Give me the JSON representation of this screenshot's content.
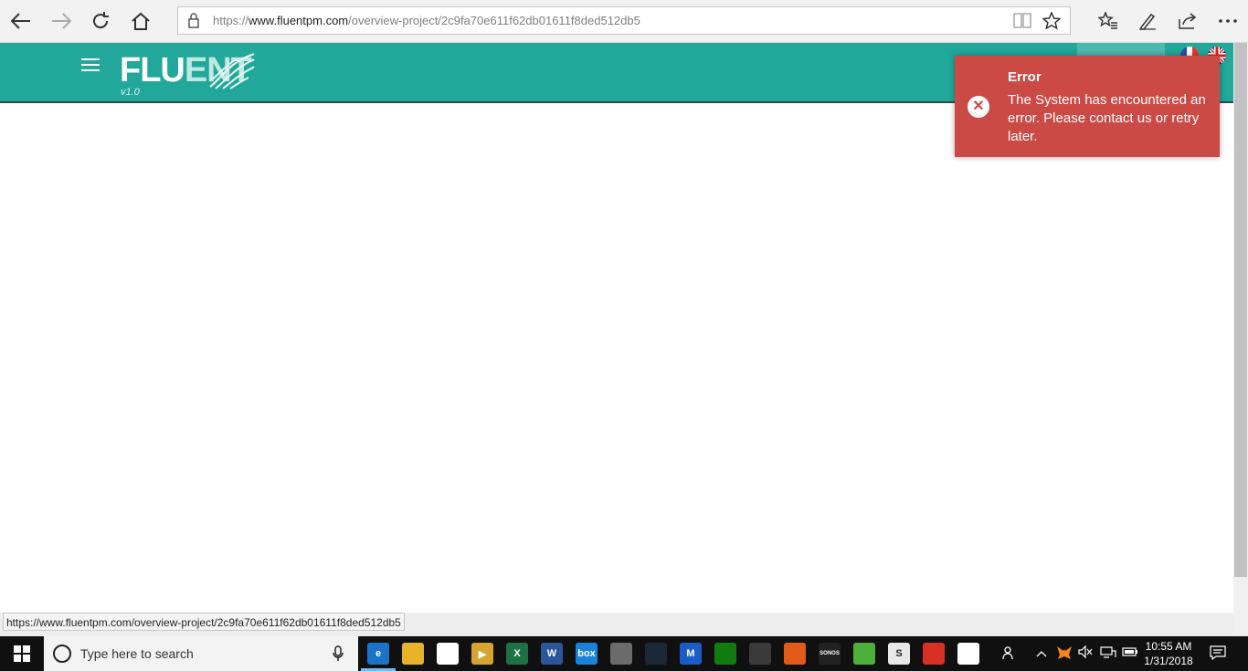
{
  "browser": {
    "url_prefix": "https://",
    "url_host": "www.fluentpm.com",
    "url_path": "/overview-project/2c9fa70e611f62db01611f8ded512db5",
    "status_url": "https://www.fluentpm.com/overview-project/2c9fa70e611f62db01611f8ded512db5",
    "icons": [
      "back-icon",
      "forward-icon",
      "refresh-icon",
      "home-icon",
      "lock-icon",
      "reading-view-icon",
      "favorite-star-icon",
      "favorites-icon",
      "notes-icon",
      "share-icon",
      "more-icon"
    ]
  },
  "app": {
    "logo_main": "FLU",
    "logo_accent": "ENT",
    "version": "v1.0",
    "accent_color": "#21a89a"
  },
  "toast": {
    "title": "Error",
    "message": "The System has encountered an error. Please contact us or retry later.",
    "color": "#cc4a45"
  },
  "taskbar": {
    "search_placeholder": "Type here to search",
    "time": "10:55 AM",
    "date": "1/31/2018",
    "apps": [
      {
        "name": "edge",
        "glyph": "e",
        "color": "#1a73c8"
      },
      {
        "name": "file-explorer",
        "glyph": "",
        "color": "#e8b32a"
      },
      {
        "name": "store",
        "glyph": "",
        "color": "#ffffff"
      },
      {
        "name": "media-player",
        "glyph": "▶",
        "color": "#d5a431"
      },
      {
        "name": "excel",
        "glyph": "X",
        "color": "#1e7145"
      },
      {
        "name": "word",
        "glyph": "W",
        "color": "#2b579a"
      },
      {
        "name": "box",
        "glyph": "box",
        "color": "#1a82d8"
      },
      {
        "name": "gimp",
        "glyph": "",
        "color": "#6b6b6b"
      },
      {
        "name": "steam",
        "glyph": "",
        "color": "#1b2838"
      },
      {
        "name": "malwarebytes",
        "glyph": "M",
        "color": "#1a5dc8"
      },
      {
        "name": "xbox-app",
        "glyph": "",
        "color": "#107c10"
      },
      {
        "name": "calculator",
        "glyph": "",
        "color": "#3a3a3a"
      },
      {
        "name": "origin",
        "glyph": "",
        "color": "#e05a1a"
      },
      {
        "name": "sonos",
        "glyph": "SONOS",
        "color": "#222222"
      },
      {
        "name": "green-app",
        "glyph": "",
        "color": "#4caf3a"
      },
      {
        "name": "slack",
        "glyph": "S",
        "color": "#e8e8e8"
      },
      {
        "name": "chrome",
        "glyph": "",
        "color": "#d93025"
      },
      {
        "name": "mail",
        "glyph": "",
        "color": "#ffffff"
      }
    ]
  }
}
